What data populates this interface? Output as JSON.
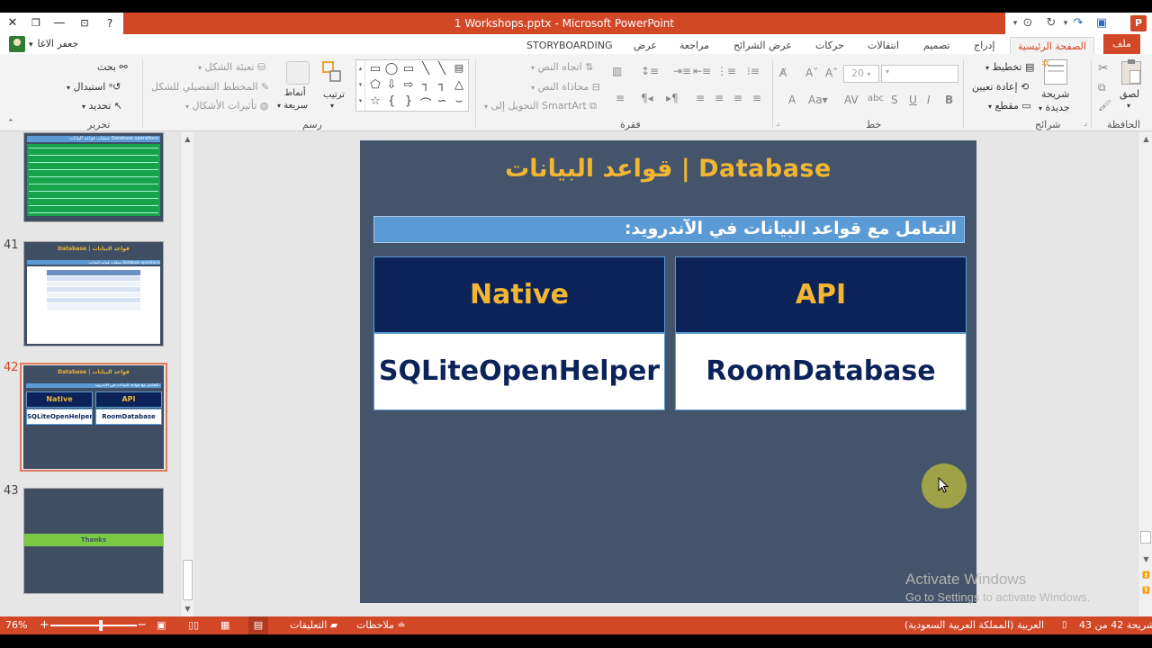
{
  "window": {
    "title": "1 Workshops.pptx -  Microsoft PowerPoint",
    "app_logo": "P"
  },
  "tabs": {
    "file": "ملف",
    "home": "الصفحة الرئيسية",
    "insert": "إدراج",
    "design": "تصميم",
    "transitions": "انتقالات",
    "animations": "حركات",
    "slideshow": "عرض الشرائح",
    "review": "مراجعة",
    "view": "عرض",
    "storyboarding": "STORYBOARDING",
    "user": "جعفر الاغا"
  },
  "ribbon": {
    "clipboard": {
      "label": "الحافظة",
      "paste": "لصق"
    },
    "slides": {
      "label": "شرائح",
      "new_slide_1": "شريحة",
      "new_slide_2": "جديدة",
      "layout": "تخطيط",
      "reset": "إعادة تعيين",
      "section": "مقطع"
    },
    "font": {
      "label": "خط",
      "size": "20"
    },
    "paragraph": {
      "label": "فقرة",
      "text_direction": "اتجاه النص",
      "align_text": "محاذاة النص",
      "smartart": "التحويل إلى SmartArt"
    },
    "drawing": {
      "label": "رسم",
      "arrange": "ترتيب",
      "quick_styles_1": "أنماط",
      "quick_styles_2": "سريعة",
      "shape_fill": "تعبئة الشكل",
      "shape_outline": "المخطط التفصيلي للشكل",
      "shape_effects": "تأثيرات الأشكال"
    },
    "editing": {
      "label": "تحرير",
      "find": "بحث",
      "replace": "استبدال",
      "select": "تحديد"
    }
  },
  "thumbnails": [
    {
      "number": "",
      "title": "",
      "band": "عمليات قواعد البيانات Database operations"
    },
    {
      "number": "41",
      "title": "Database | قواعد البيانات",
      "band": "عمليات قواعد البيانات Database operations"
    },
    {
      "number": "42",
      "title": "Database | قواعد البيانات",
      "band": "التعامل مع قواعد البيانات في الاندرويد:",
      "cells": [
        "Native",
        "API",
        "SQLiteOpenHelper",
        "RoomDatabase"
      ]
    },
    {
      "number": "43",
      "title": "",
      "band": "Thanks"
    }
  ],
  "slide": {
    "title": "قواعد البيانات | Database",
    "subtitle": "التعامل مع قواعد البيانات في الآندرويد:",
    "left_head": "Native",
    "right_head": "API",
    "left_body": "SQLiteOpenHelper",
    "right_body": "RoomDatabase"
  },
  "watermark": {
    "line1": "Activate Windows",
    "line2": "Go to Settings to activate Windows."
  },
  "statusbar": {
    "zoom": "76%",
    "comments": "التعليقات",
    "notes": "ملاحظات",
    "language": "العربية (المملكة العربية السعودية)",
    "slide_info": "شريحة 42 من 43"
  },
  "colors": {
    "accent": "#d24726",
    "slide_bg": "#44546a",
    "title_gold": "#f2b632",
    "navy": "#0b2358",
    "band_blue": "#5b9bd5"
  }
}
